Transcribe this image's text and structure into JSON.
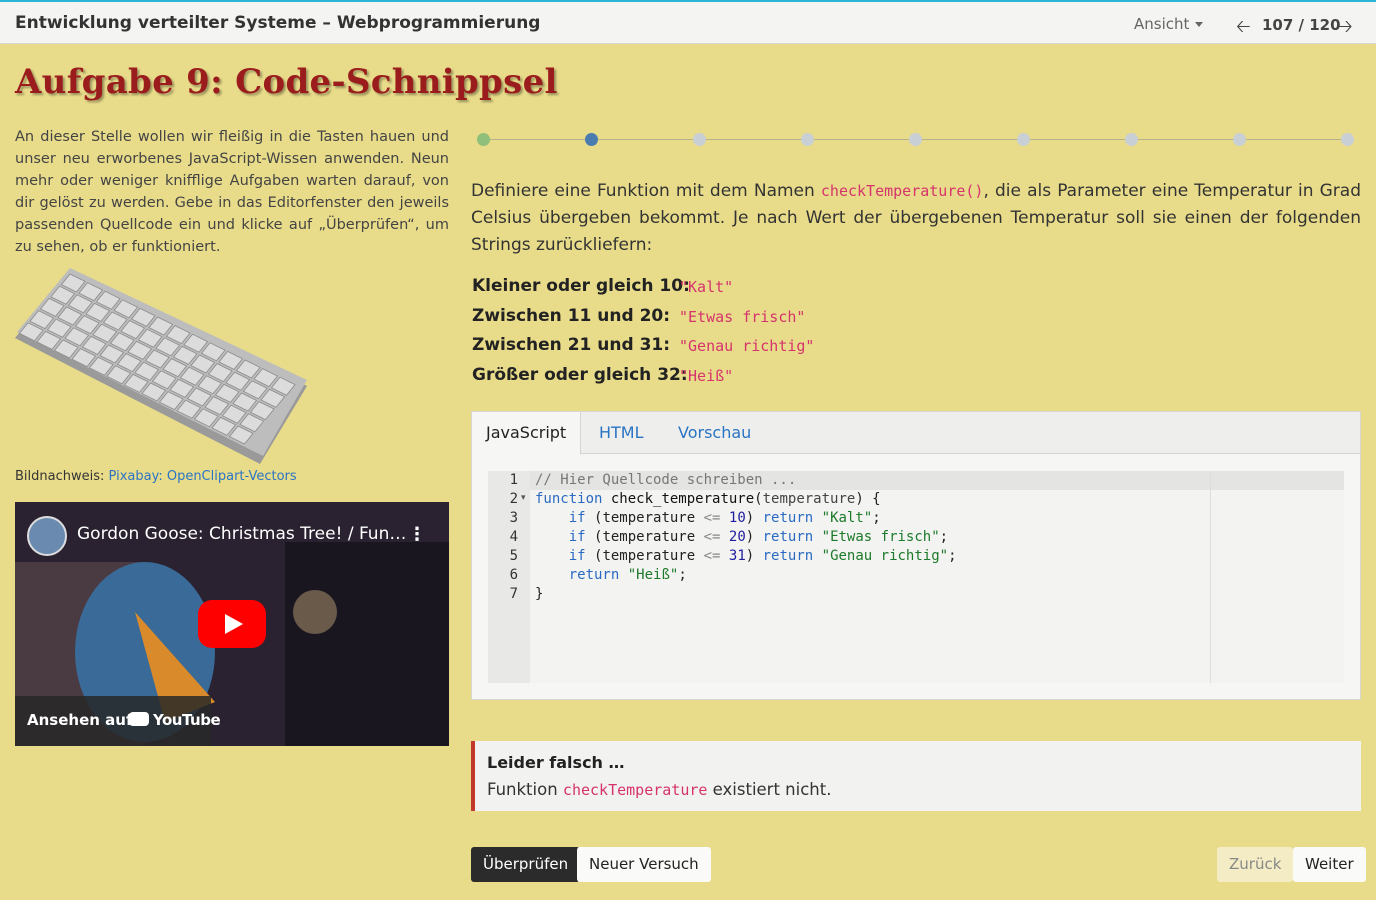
{
  "header": {
    "title": "Entwicklung verteilter Systeme – Webprogrammierung",
    "view_label": "Ansicht",
    "page": "107 / 120"
  },
  "heading": "Aufgabe 9: Code-Schnippsel",
  "intro": "An dieser Stelle wollen wir fleißig in die Tasten hauen und unser neu erworbenes JavaScript-Wissen anwenden. Neun mehr oder weniger knifflige Aufgaben warten darauf, von dir gelöst zu werden. Gebe in das Editorfenster den jeweils passenden Quellcode ein und klicke auf „Überprüfen“, um zu sehen, ob er funktioniert.",
  "credit": {
    "label": "Bildnachweis:",
    "link": "Pixabay: OpenClipart-Vectors"
  },
  "video": {
    "title": "Gordon Goose: Christmas Tree! / Fun…",
    "watch_label": "Ansehen auf",
    "brand": "YouTube"
  },
  "progress": {
    "total": 9,
    "done_index": 0,
    "current_index": 1,
    "colors": {
      "done": "#8fbf7a",
      "current": "#4a7cb0",
      "pending": "#c8d0d6"
    }
  },
  "task": {
    "part1": "Definiere eine Funktion mit dem Namen ",
    "code": "checkTemperature()",
    "part2": ", die als Parameter eine Temperatur in Grad Celsius übergeben bekommt. Je nach Wert der übergebenen Temperatur soll sie einen der folgenden Strings zurückliefern:"
  },
  "rules": [
    {
      "label": "Kleiner oder gleich 10:",
      "value": "\"Kalt\""
    },
    {
      "label": "Zwischen 11 und 20:",
      "value": "\"Etwas frisch\""
    },
    {
      "label": "Zwischen 21 und 31:",
      "value": "\"Genau richtig\""
    },
    {
      "label": "Größer oder gleich 32:",
      "value": "\"Heiß\""
    }
  ],
  "editor": {
    "tabs": [
      "JavaScript",
      "HTML",
      "Vorschau"
    ],
    "active_tab": 0,
    "line_numbers": [
      "1",
      "2",
      "3",
      "4",
      "5",
      "6",
      "7"
    ],
    "code": {
      "l1": "// Hier Quellcode schreiben ...",
      "l2_kw": "function",
      "l2_fn": "check_temperature",
      "l2_param": "temperature",
      "l2_end": ") {",
      "l3_kw": "if",
      "l3_var": "(temperature",
      "l3_op": "<=",
      "l3_num": "10",
      "l3_ret": "return",
      "l3_str": "\"Kalt\"",
      "l4_kw": "if",
      "l4_var": "(temperature",
      "l4_op": "<=",
      "l4_num": "20",
      "l4_ret": "return",
      "l4_str": "\"Etwas frisch\"",
      "l5_kw": "if",
      "l5_var": "(temperature",
      "l5_op": "<=",
      "l5_num": "31",
      "l5_ret": "return",
      "l5_str": "\"Genau richtig\"",
      "l6_ret": "return",
      "l6_str": "\"Heiß\"",
      "l7": "}"
    }
  },
  "feedback": {
    "title": "Leider falsch …",
    "msg_before": "Funktion ",
    "msg_code": "checkTemperature",
    "msg_after": " existiert nicht."
  },
  "buttons": {
    "check": "Überprüfen",
    "retry": "Neuer Versuch",
    "back": "Zurück",
    "next": "Weiter"
  }
}
